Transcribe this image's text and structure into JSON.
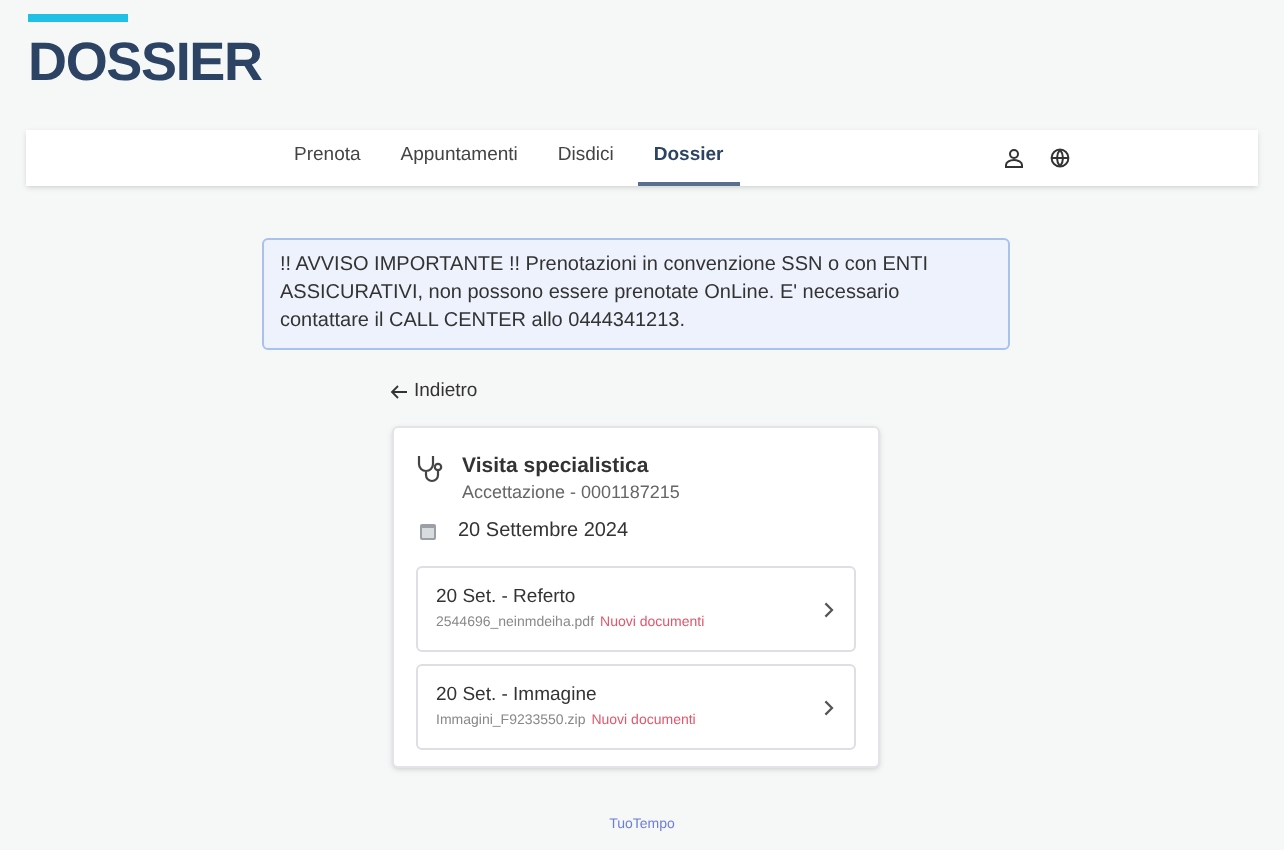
{
  "page_title": "DOSSIER",
  "nav": {
    "tabs": [
      {
        "label": "Prenota",
        "selected": false
      },
      {
        "label": "Appuntamenti",
        "selected": false
      },
      {
        "label": "Disdici",
        "selected": false
      },
      {
        "label": "Dossier",
        "selected": true
      }
    ]
  },
  "notice": "!! AVVISO IMPORTANTE !! Prenotazioni in convenzione SSN o con ENTI ASSICURATIVI, non possono essere prenotate OnLine. E' necessario contattare il CALL CENTER allo 0444341213.",
  "back_link": "Indietro",
  "visit": {
    "title": "Visita specialistica",
    "subtitle": "Accettazione - 0001187215",
    "date": "20 Settembre 2024",
    "documents": [
      {
        "title": "20 Set. - Referto",
        "file": "2544696_neinmdeiha.pdf",
        "badge": "Nuovi documenti"
      },
      {
        "title": "20 Set. - Immagine",
        "file": "Immagini_F9233550.zip",
        "badge": "Nuovi documenti"
      }
    ]
  },
  "footer": "TuoTempo"
}
